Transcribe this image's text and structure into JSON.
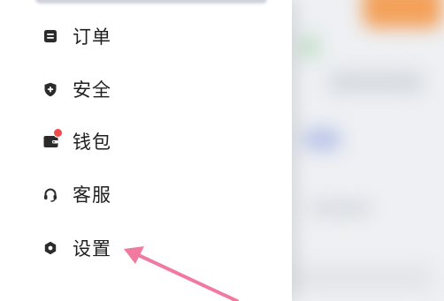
{
  "menu": {
    "items": [
      {
        "label": "订单",
        "icon": "receipt-icon"
      },
      {
        "label": "安全",
        "icon": "shield-icon"
      },
      {
        "label": "钱包",
        "icon": "wallet-icon",
        "badge": "red-dot"
      },
      {
        "label": "客服",
        "icon": "headset-icon"
      },
      {
        "label": "设置",
        "icon": "gear-icon"
      }
    ]
  },
  "annotation": {
    "arrow_color": "#f07aa0",
    "target": "设置"
  },
  "colors": {
    "text": "#1f1f1f",
    "icon": "#2b2b2b",
    "badge": "#f24a4a"
  }
}
